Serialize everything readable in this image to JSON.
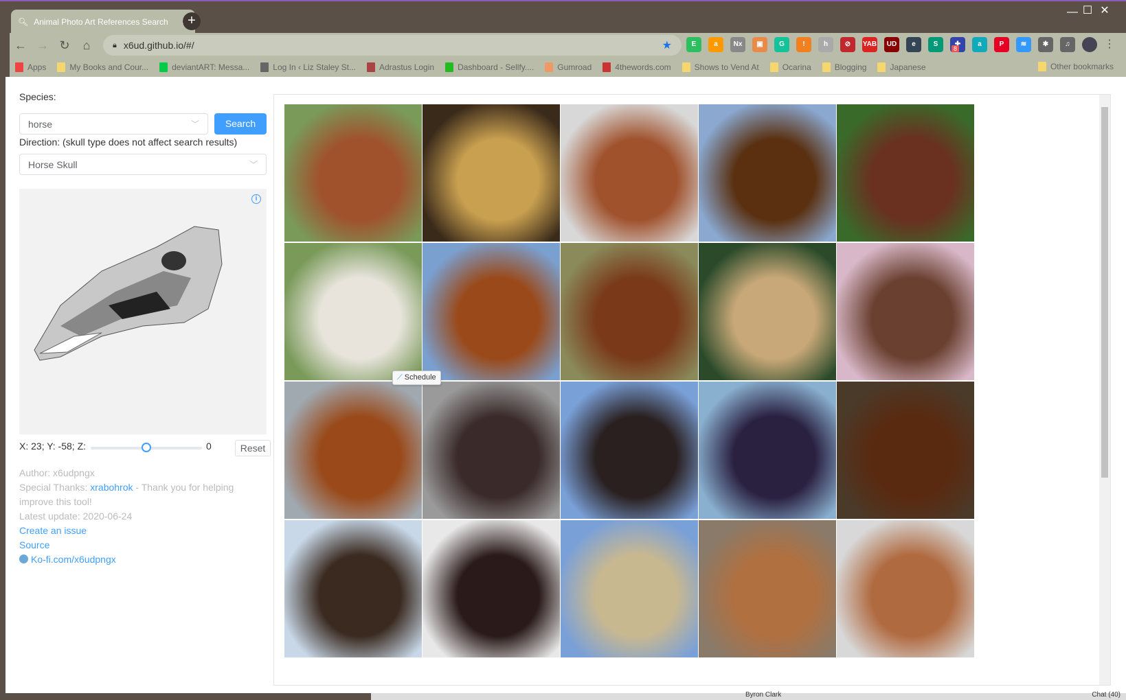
{
  "browser": {
    "tab_title": "Animal Photo Art References Search",
    "url": "x6ud.github.io/#/",
    "window_controls": [
      "—",
      "☐",
      "✕"
    ],
    "extensions": [
      {
        "name": "evernote",
        "label": "E",
        "color": "#2dbe60"
      },
      {
        "name": "amazon",
        "label": "a",
        "color": "#f90"
      },
      {
        "name": "nx",
        "label": "Nx",
        "color": "#888"
      },
      {
        "name": "image",
        "label": "▣",
        "color": "#e88a4a"
      },
      {
        "name": "grammarly",
        "label": "G",
        "color": "#15c39a"
      },
      {
        "name": "key",
        "label": "!",
        "color": "#f08020"
      },
      {
        "name": "h",
        "label": "h",
        "color": "#aaa"
      },
      {
        "name": "block",
        "label": "⊘",
        "color": "#c0282d"
      },
      {
        "name": "yab",
        "label": "YAB",
        "color": "#d22"
      },
      {
        "name": "ublock",
        "label": "UD",
        "color": "#800"
      },
      {
        "name": "e",
        "label": "e",
        "color": "#345"
      },
      {
        "name": "s",
        "label": "S",
        "color": "#097"
      },
      {
        "name": "flag",
        "label": "✚",
        "color": "#34a"
      },
      {
        "name": "a8",
        "label": "a",
        "color": "#1ab"
      },
      {
        "name": "pinterest",
        "label": "P",
        "color": "#e60023"
      },
      {
        "name": "wing",
        "label": "≋",
        "color": "#39f"
      },
      {
        "name": "puzzle",
        "label": "✱",
        "color": "#666"
      },
      {
        "name": "media",
        "label": "♫",
        "color": "#666"
      }
    ],
    "badge": "8",
    "bookmarks": [
      {
        "label": "Apps",
        "icon": "apps"
      },
      {
        "label": "My Books and Cour...",
        "icon": "folder"
      },
      {
        "label": "deviantART: Messa...",
        "icon": "deviantart"
      },
      {
        "label": "Log In ‹ Liz Staley St...",
        "icon": "globe"
      },
      {
        "label": "Adrastus Login",
        "icon": "site"
      },
      {
        "label": "Dashboard - Sellfy....",
        "icon": "sellfy"
      },
      {
        "label": "Gumroad",
        "icon": "gumroad"
      },
      {
        "label": "4thewords.com",
        "icon": "4thewords"
      },
      {
        "label": "Shows to Vend At",
        "icon": "folder"
      },
      {
        "label": "Ocarina",
        "icon": "folder"
      },
      {
        "label": "Blogging",
        "icon": "folder"
      },
      {
        "label": "Japanese",
        "icon": "folder"
      }
    ],
    "other_bookmarks": "Other bookmarks"
  },
  "left": {
    "species_label": "Species:",
    "species_value": "horse",
    "search_label": "Search",
    "direction_label": "Direction: (skull type does not affect search results)",
    "skull_value": "Horse Skull",
    "coords": "X: 23; Y: -58; Z:",
    "z_value": "0",
    "slider_fraction": 0.5,
    "reset_label": "Reset",
    "author": "Author: x6udpngx",
    "thanks_prefix": "Special Thanks: ",
    "thanks_name": "xrabohrok",
    "thanks_suffix": " - Thank you for helping improve this tool!",
    "latest": "Latest update: 2020-06-24",
    "issue": "Create an issue",
    "source": "Source",
    "kofi": "Ko-fi.com/x6udpngx"
  },
  "tooltip": "Schedule",
  "photos": [
    [
      "#a0522d",
      "#7a9a5a"
    ],
    [
      "#c9a050",
      "#3a2a1a"
    ],
    [
      "#a0522d",
      "#d8d8d8"
    ],
    [
      "#5a3010",
      "#8aa8d0"
    ],
    [
      "#6a3020",
      "#3a6a2a"
    ],
    [
      "#e8e4dc",
      "#7a9a5a"
    ],
    [
      "#9a4a1a",
      "#7aa0d0"
    ],
    [
      "#7a3a1a",
      "#8a8a5a"
    ],
    [
      "#c8a878",
      "#2a4a2a"
    ],
    [
      "#6a4030",
      "#d8b8c8"
    ],
    [
      "#9a4a1a",
      "#a0a8b0"
    ],
    [
      "#3a2a2a",
      "#9a9a9a"
    ],
    [
      "#2a2020",
      "#7aa0d8"
    ],
    [
      "#2a2040",
      "#8ab0d0"
    ],
    [
      "#5a2a10",
      "#4a3a2a"
    ],
    [
      "#3a2a20",
      "#c8d8e8"
    ],
    [
      "#2a1a1a",
      "#e8e8e8"
    ],
    [
      "#c8b890",
      "#7aa0d8"
    ],
    [
      "#b07040",
      "#8a7a6a"
    ],
    [
      "#b06a40",
      "#d8d8d8"
    ]
  ],
  "footer_taskbar": {
    "contact": "Byron Clark",
    "chat": "Chat (40)"
  }
}
